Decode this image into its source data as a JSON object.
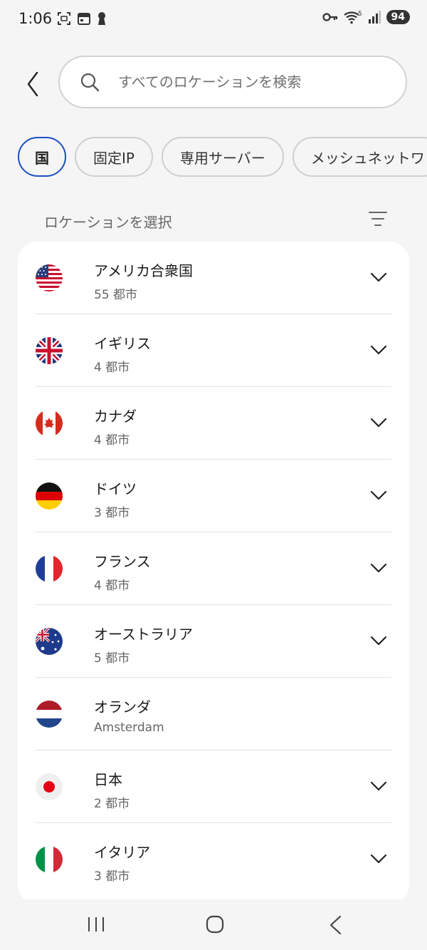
{
  "status_bar": {
    "time": "1:06",
    "battery": "94",
    "network": "5"
  },
  "search": {
    "placeholder": "すべてのロケーションを検索"
  },
  "chips": [
    {
      "label": "国",
      "active": true
    },
    {
      "label": "固定IP",
      "active": false
    },
    {
      "label": "専用サーバー",
      "active": false
    },
    {
      "label": "メッシュネットワ",
      "active": false
    }
  ],
  "section": {
    "title": "ロケーションを選択"
  },
  "locations": [
    {
      "name": "アメリカ合衆国",
      "sub": "55 都市",
      "flag": "us-flag-icon",
      "expandable": true
    },
    {
      "name": "イギリス",
      "sub": "4 都市",
      "flag": "uk-flag-icon",
      "expandable": true
    },
    {
      "name": "カナダ",
      "sub": "4 都市",
      "flag": "canada-flag-icon",
      "expandable": true
    },
    {
      "name": "ドイツ",
      "sub": "3 都市",
      "flag": "germany-flag-icon",
      "expandable": true
    },
    {
      "name": "フランス",
      "sub": "4 都市",
      "flag": "france-flag-icon",
      "expandable": true
    },
    {
      "name": "オーストラリア",
      "sub": "5 都市",
      "flag": "australia-flag-icon",
      "expandable": true
    },
    {
      "name": "オランダ",
      "sub": "Amsterdam",
      "flag": "netherlands-flag-icon",
      "expandable": false
    },
    {
      "name": "日本",
      "sub": "2 都市",
      "flag": "japan-flag-icon",
      "expandable": true
    },
    {
      "name": "イタリア",
      "sub": "3 都市",
      "flag": "italy-flag-icon",
      "expandable": true
    }
  ],
  "colors": {
    "accent": "#1d4fc4",
    "card": "#ffffff",
    "background": "#f5f5f5"
  }
}
